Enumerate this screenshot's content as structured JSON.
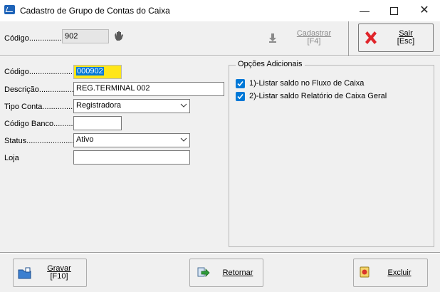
{
  "window": {
    "title": "Cadastro de Grupo de Contas do Caixa",
    "minimize_glyph": "—",
    "close_glyph": "✕"
  },
  "toolbar": {
    "codigo_label": "Código.................",
    "codigo_value": "902",
    "cadastrar": {
      "line1": "Cadastrar",
      "line2": "[F4]",
      "enabled": false
    },
    "sair": {
      "line1": "Sair",
      "line2": "[Esc]"
    }
  },
  "form": {
    "codigo": {
      "label": "Código........................",
      "value": "000902"
    },
    "descricao": {
      "label": "Descrição....................",
      "value": "REG.TERMINAL 002"
    },
    "tipo_conta": {
      "label": "Tipo Conta.................",
      "value": "Registradora"
    },
    "codigo_banco": {
      "label": "Código Banco...........",
      "value": ""
    },
    "status": {
      "label": "Status........................",
      "value": "Ativo"
    },
    "loja": {
      "label": "Loja",
      "value": ""
    }
  },
  "opcoes": {
    "title": "Opções Adicionais",
    "items": [
      {
        "label": "1)-Listar saldo no Fluxo de Caixa",
        "checked": true
      },
      {
        "label": "2)-Listar saldo Relatório de Caixa Geral",
        "checked": true
      }
    ]
  },
  "bottom": {
    "gravar": {
      "line1": "Gravar",
      "line2": "[F10]"
    },
    "retornar": {
      "label": "Retornar"
    },
    "excluir": {
      "label": "Excluir"
    }
  },
  "colors": {
    "accent": "#0078d7",
    "required_field": "#ffe619",
    "close_icon": "#e0252b"
  },
  "icons": {
    "app": "app-icon",
    "hand": "hand-icon",
    "cadastrar": "arrow-down-icon",
    "sair": "red-x-icon",
    "gravar": "folder-save-icon",
    "retornar": "return-arrow-icon",
    "excluir": "delete-icon"
  }
}
